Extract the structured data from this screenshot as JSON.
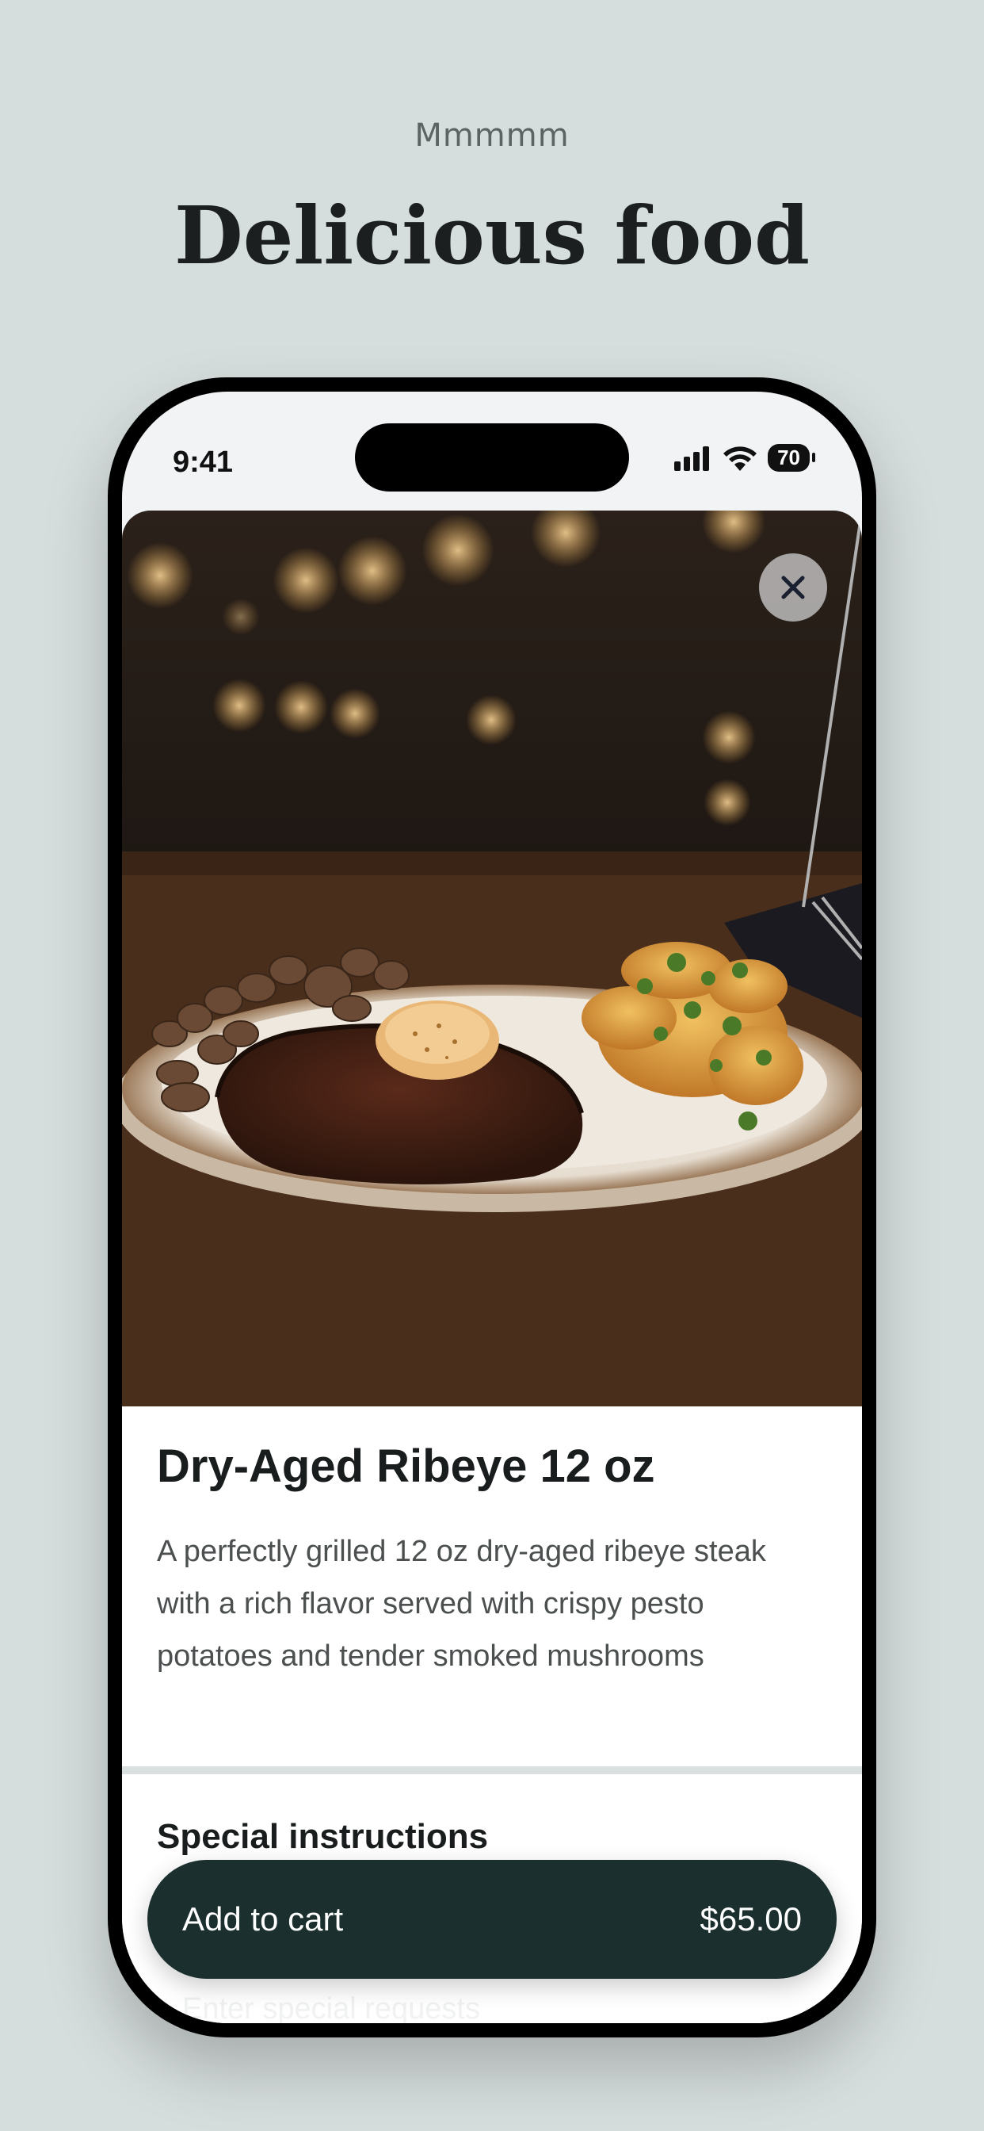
{
  "header": {
    "eyebrow": "Mmmmm",
    "headline": "Delicious food"
  },
  "status_bar": {
    "time": "9:41",
    "battery": "70",
    "icons": [
      "cellular-signal-icon",
      "wifi-icon",
      "battery-icon"
    ]
  },
  "product": {
    "image_alt": "Steak dinner",
    "name": "Dry-Aged Ribeye 12 oz",
    "description": "A perfectly grilled 12 oz dry-aged ribeye steak with a rich flavor served with crispy pesto potatoes and tender smoked mushrooms",
    "close_icon": "close-icon"
  },
  "special_instructions": {
    "title": "Special instructions",
    "placeholder": "Enter special requests"
  },
  "cart_button": {
    "label": "Add to cart",
    "price": "$65.00"
  },
  "colors": {
    "page_bg": "#d6dedd",
    "button_bg": "#1a2f2e"
  }
}
